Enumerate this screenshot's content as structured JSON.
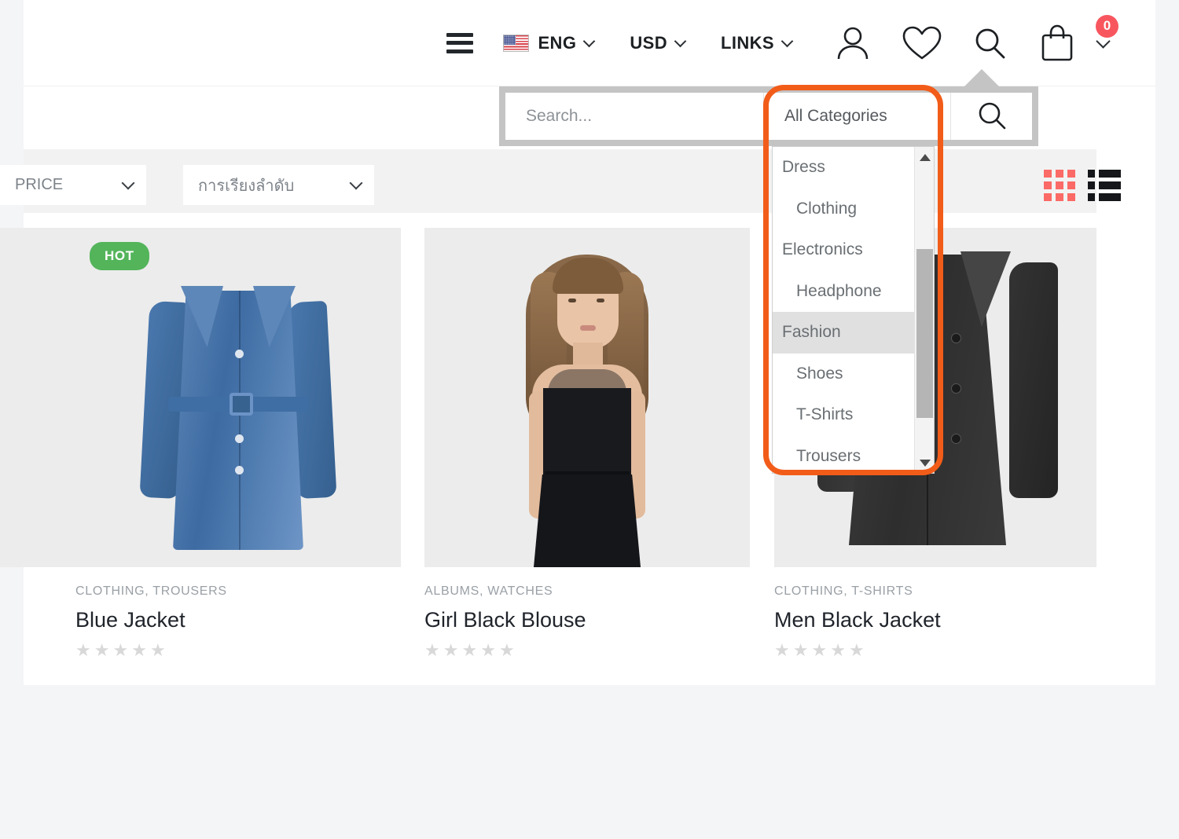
{
  "header": {
    "menu_icon": "hamburger-menu-icon",
    "language": {
      "label": "ENG",
      "flag": "us-flag-icon"
    },
    "currency": {
      "label": "USD"
    },
    "links": {
      "label": "LINKS"
    },
    "account_icon": "user-account-icon",
    "wishlist_icon": "heart-icon",
    "search_icon": "search-icon",
    "cart_icon": "shopping-bag-icon",
    "cart_count": "0"
  },
  "search_popup": {
    "input_value": "",
    "input_placeholder": "Search...",
    "category_selected": "All Categories",
    "submit_icon": "search-icon"
  },
  "category_dropdown": {
    "items": [
      {
        "label": "Dress",
        "level": 0,
        "active": false
      },
      {
        "label": "Clothing",
        "level": 1,
        "active": false
      },
      {
        "label": "Electronics",
        "level": 0,
        "active": false
      },
      {
        "label": "Headphone",
        "level": 1,
        "active": false
      },
      {
        "label": "Fashion",
        "level": 0,
        "active": true
      },
      {
        "label": "Shoes",
        "level": 1,
        "active": false
      },
      {
        "label": "T-Shirts",
        "level": 1,
        "active": false
      },
      {
        "label": "Trousers",
        "level": 1,
        "active": false
      }
    ],
    "scroll_up_icon": "scroll-up-arrow-icon",
    "scroll_down_icon": "scroll-down-arrow-icon",
    "highlight_color": "#f25c19"
  },
  "filter_bar": {
    "price": {
      "label": "PRICE"
    },
    "sort": {
      "label": "การเรียงลำดับ"
    },
    "grid_view_icon": "grid-view-icon",
    "list_view_icon": "list-view-icon",
    "active_view": "grid",
    "grid_icon_color": "#fb6a66",
    "list_icon_color": "#15171a"
  },
  "products": [
    {
      "id": "partial-left",
      "categories": "",
      "title": "",
      "badge": "",
      "rating": 0
    },
    {
      "id": "blue-jacket",
      "categories": "CLOTHING, TROUSERS",
      "title": "Blue Jacket",
      "badge": "HOT",
      "badge_color": "#53b45a",
      "rating": 0
    },
    {
      "id": "girl-black-blouse",
      "categories": "ALBUMS, WATCHES",
      "title": "Girl Black Blouse",
      "badge": "",
      "rating": 0
    },
    {
      "id": "men-black-jacket",
      "categories": "CLOTHING, T-SHIRTS",
      "title": "Men Black Jacket",
      "badge": "",
      "rating": 0
    }
  ],
  "stars_per_product": 5
}
